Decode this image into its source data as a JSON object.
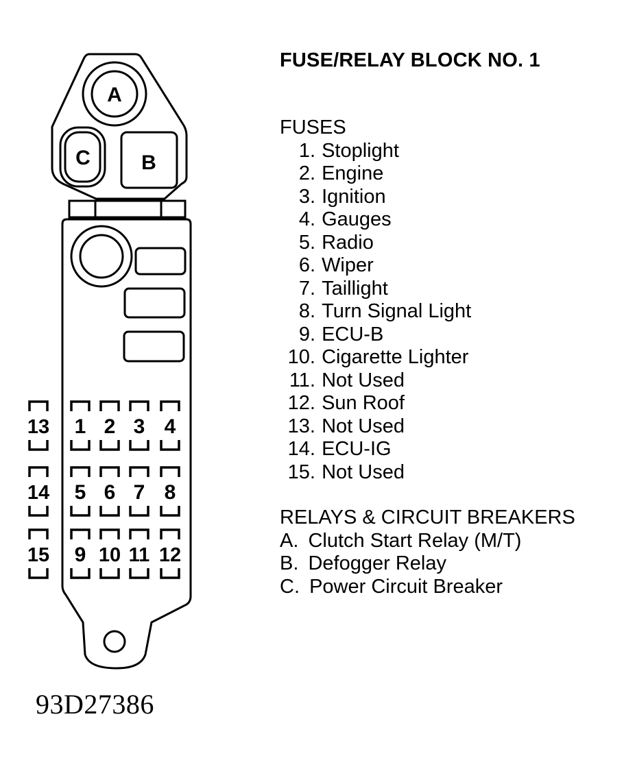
{
  "title": "FUSE/RELAY BLOCK NO. 1",
  "figure_id": "93D27386",
  "fuses": {
    "heading": "FUSES",
    "items": [
      {
        "num": "1.",
        "label": "Stoplight"
      },
      {
        "num": "2.",
        "label": "Engine"
      },
      {
        "num": "3.",
        "label": "Ignition"
      },
      {
        "num": "4.",
        "label": "Gauges"
      },
      {
        "num": "5.",
        "label": "Radio"
      },
      {
        "num": "6.",
        "label": "Wiper"
      },
      {
        "num": "7.",
        "label": "Taillight"
      },
      {
        "num": "8.",
        "label": "Turn Signal Light"
      },
      {
        "num": "9.",
        "label": "ECU-B"
      },
      {
        "num": "10.",
        "label": "Cigarette Lighter"
      },
      {
        "num": "11.",
        "label": "Not Used"
      },
      {
        "num": "12.",
        "label": "Sun Roof"
      },
      {
        "num": "13.",
        "label": "Not Used"
      },
      {
        "num": "14.",
        "label": "ECU-IG"
      },
      {
        "num": "15.",
        "label": "Not Used"
      }
    ]
  },
  "relays": {
    "heading": "RELAYS & CIRCUIT BREAKERS",
    "items": [
      {
        "num": "A.",
        "label": "Clutch Start Relay (M/T)"
      },
      {
        "num": "B.",
        "label": "Defogger Relay"
      },
      {
        "num": "C.",
        "label": "Power Circuit Breaker"
      }
    ]
  },
  "diagram": {
    "relay_labels": {
      "a": "A",
      "b": "B",
      "c": "C"
    },
    "fuse_slots": {
      "main_grid": [
        [
          "1",
          "2",
          "3",
          "4"
        ],
        [
          "5",
          "6",
          "7",
          "8"
        ],
        [
          "9",
          "10",
          "11",
          "12"
        ]
      ],
      "side_column": [
        "13",
        "14",
        "15"
      ]
    }
  }
}
